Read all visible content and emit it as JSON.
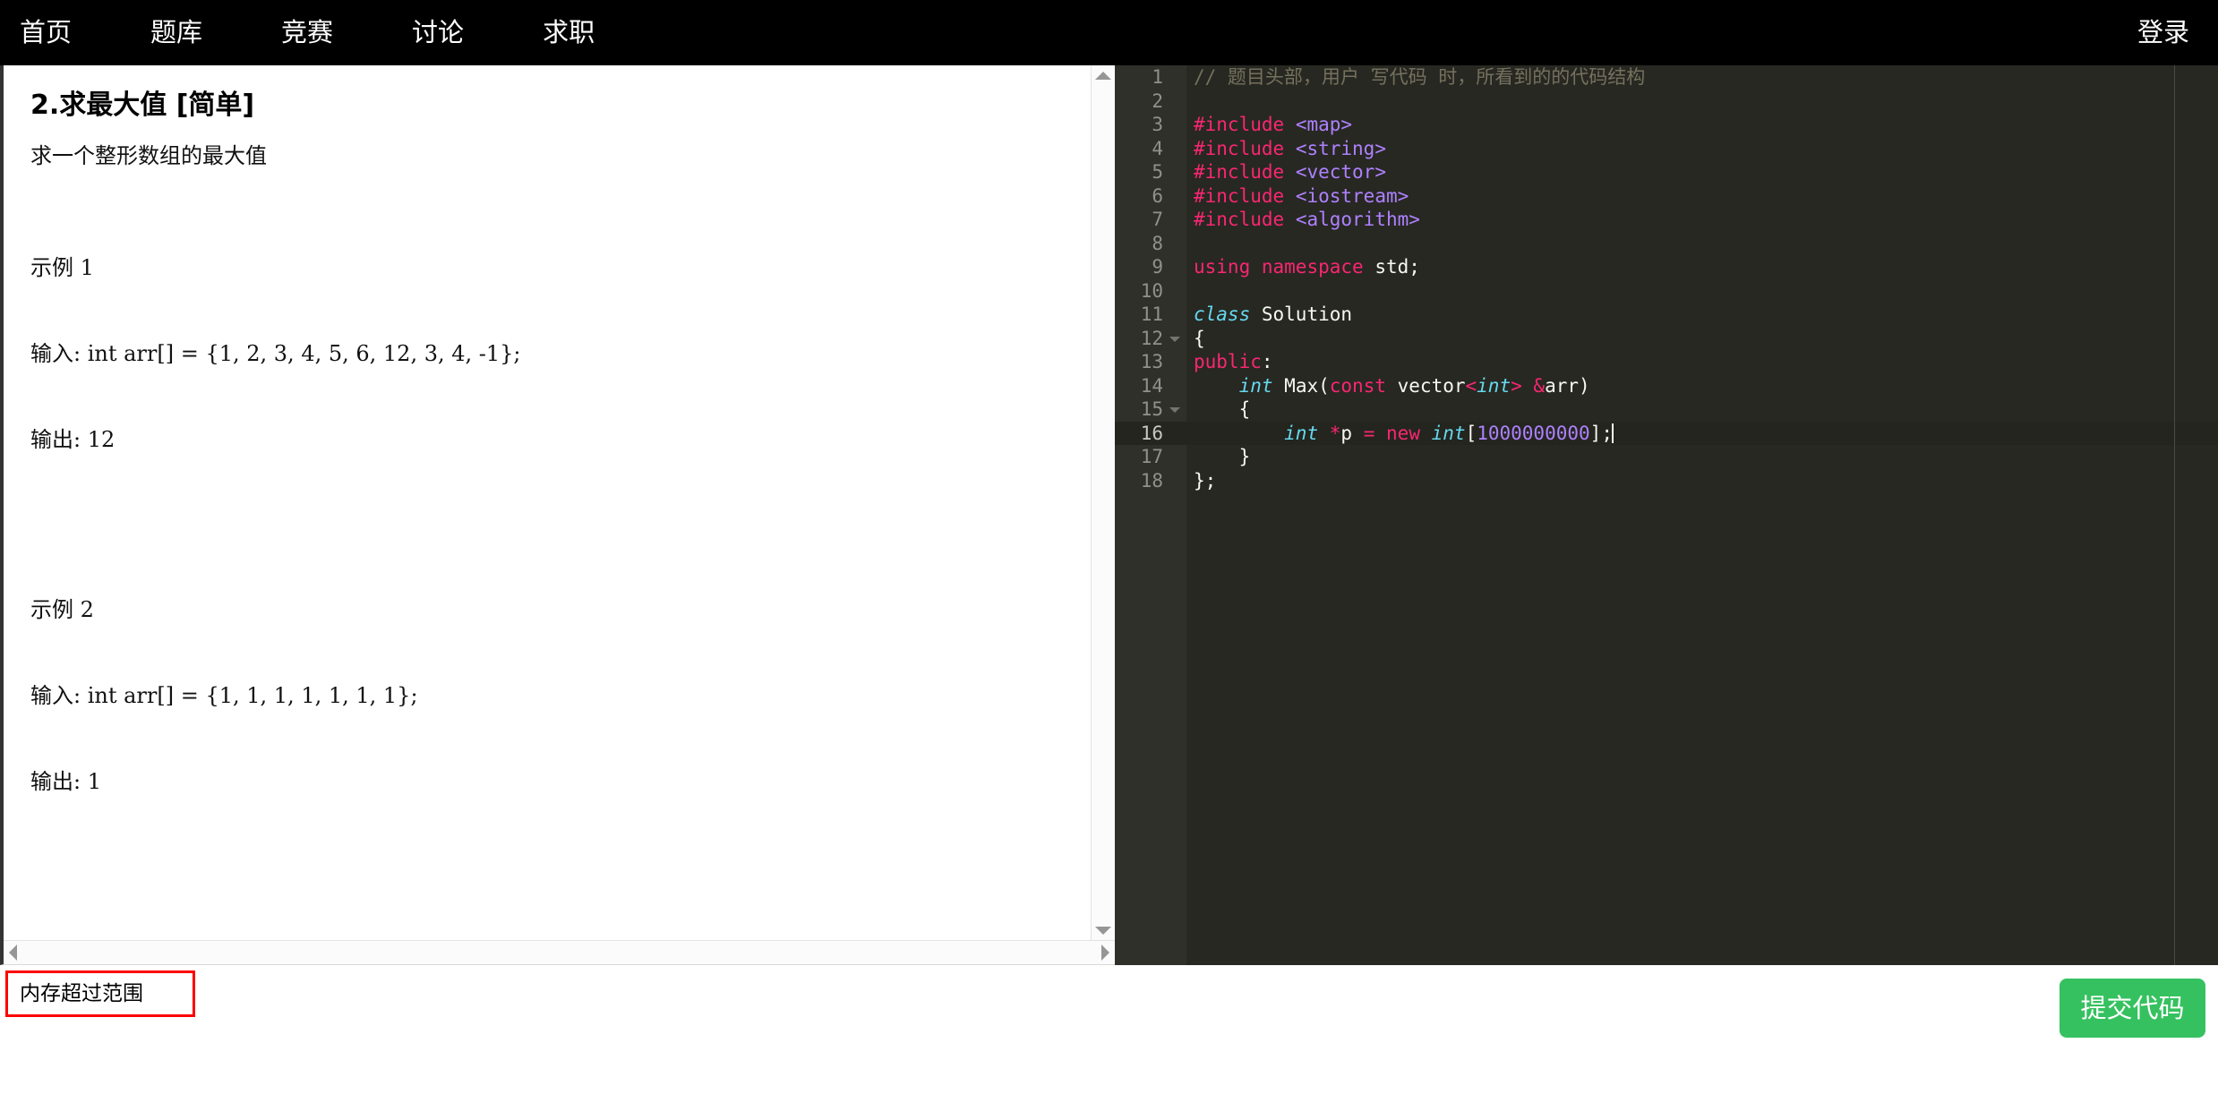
{
  "nav": {
    "items": [
      {
        "label": "首页",
        "name": "nav-item-home"
      },
      {
        "label": "题库",
        "name": "nav-item-problems"
      },
      {
        "label": "竞赛",
        "name": "nav-item-contest"
      },
      {
        "label": "讨论",
        "name": "nav-item-discuss"
      },
      {
        "label": "求职",
        "name": "nav-item-jobs"
      }
    ],
    "login_label": "登录",
    "background": "#000000"
  },
  "problem": {
    "title": "2.求最大值 [简单]",
    "description": "求一个整形数组的最大值",
    "examples": [
      {
        "heading": "示例 1",
        "input": "输入: int arr[] = {1, 2, 3, 4, 5, 6, 12, 3, 4, -1};",
        "output": "输出: 12"
      },
      {
        "heading": "示例 2",
        "input": "输入: int arr[] = {1, 1, 1, 1, 1, 1, 1};",
        "output": "输出: 1"
      }
    ]
  },
  "editor": {
    "language": "cpp",
    "theme": "monokai",
    "active_line": 16,
    "cursor_line": 16,
    "total_lines": 18,
    "line_numbers": [
      1,
      2,
      3,
      4,
      5,
      6,
      7,
      8,
      9,
      10,
      11,
      12,
      13,
      14,
      15,
      16,
      17,
      18
    ],
    "fold_lines": [
      12,
      15
    ],
    "lines": [
      "// 题目头部，用户 写代码 时，所看到的的代码结构",
      "",
      "#include <map>",
      "#include <string>",
      "#include <vector>",
      "#include <iostream>",
      "#include <algorithm>",
      "",
      "using namespace std;",
      "",
      "class Solution",
      "{",
      "public:",
      "    int Max(const vector<int> &arr)",
      "    {",
      "        int *p = new int[1000000000];",
      "    }",
      "};"
    ],
    "colors": {
      "background": "#272822",
      "gutter_background": "#2f302a",
      "active_line": "#24251f",
      "comment": "#75715e",
      "keyword": "#f92672",
      "type": "#66d9ef",
      "number": "#ae81ff",
      "plain": "#f8f8f2",
      "line_number": "#90918b"
    }
  },
  "bottom": {
    "result_message": "内存超过范围",
    "result_border_color": "#ff0000",
    "submit_label": "提交代码",
    "submit_color": "#35c15f"
  }
}
